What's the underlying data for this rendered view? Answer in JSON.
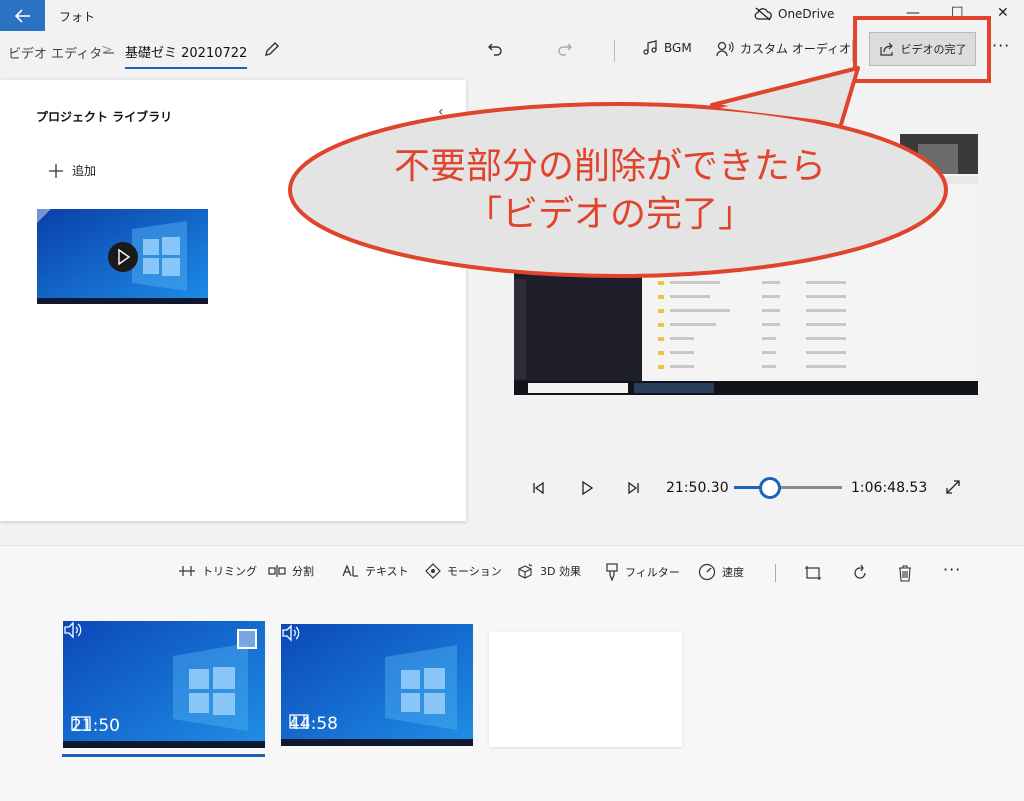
{
  "window": {
    "app_title": "フォト",
    "onedrive_label": "OneDrive"
  },
  "toolbar": {
    "breadcrumb_root": "ビデオ エディター",
    "project_name": "基礎ゼミ 20210722",
    "bgm_label": "BGM",
    "custom_audio_label": "カスタム オーディオ",
    "finish_label": "ビデオの完了"
  },
  "library": {
    "title": "プロジェクト ライブラリ",
    "add_label": "追加"
  },
  "player": {
    "current_time": "21:50.30",
    "total_time": "1:06:48.53",
    "progress": 0.33
  },
  "edit_tools": {
    "trim": "トリミング",
    "split": "分割",
    "text": "テキスト",
    "motion": "モーション",
    "effects3d": "3D 効果",
    "filter": "フィルター",
    "speed": "速度"
  },
  "storyboard": {
    "clips": [
      {
        "duration": "21:50",
        "selected": true
      },
      {
        "duration": "44:58",
        "selected": false
      }
    ]
  },
  "annotation": {
    "line1": "不要部分の削除ができたら",
    "line2": "「ビデオの完了」",
    "color": "#e0442c"
  },
  "colors": {
    "accent": "#1d63b8",
    "back_button": "#2b72c2"
  }
}
